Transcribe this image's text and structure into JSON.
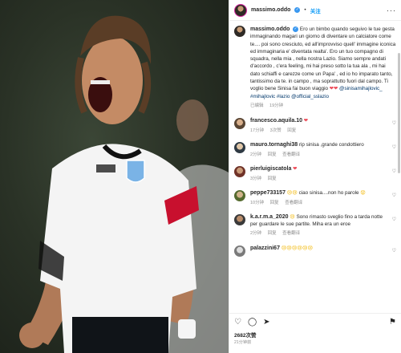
{
  "post": {
    "username": "massimo.oddo",
    "follow_label": "关注",
    "more_label": "···",
    "caption": {
      "username": "massimo.oddo",
      "text": "Ero un bimbo quando seguivo le tue gesta immaginando magari un giorno di diventare un calciatore come te.... poi sono cresciuto, ed all'improvviso quell' immagine iconica ed immaginaria e' diventata realta'. Ero un tuo compagno di squadra, nella mia , nella nostra Lazio. Siamo sempre andati d'accordo , c'era feeling, mi hai preso sotto la tua ala , mi hai dato schiaffi e carezze come un Papa' , ed io ho imparato tanto, tantissimo da te. in campo , ma soprattutto fuori dal campo. Ti voglio bene Sinisa fai buon viaggio",
      "hearts": "❤❤",
      "tags": "@sinisamihajlovic_ #mihajlovic #lazio @official_sslazio",
      "meta": [
        "已编辑",
        "19分钟"
      ]
    },
    "comments": [
      {
        "username": "francesco.aquila.10",
        "text": "",
        "suffix": "❤",
        "meta": [
          "17分钟",
          "3次赞",
          "回复"
        ]
      },
      {
        "username": "mauro.tornaghi38",
        "text": "rip sinisa ,grande condottiero",
        "suffix": "",
        "meta": [
          "2分钟",
          "回复",
          "查看翻译"
        ]
      },
      {
        "username": "pierluigiscatola",
        "text": "",
        "suffix": "❤",
        "meta": [
          "3分钟",
          "回复"
        ]
      },
      {
        "username": "peppe733157",
        "text": "ciao sinisa....non ho parole",
        "prefix": "😢😢",
        "suffix": "😟",
        "meta": [
          "10分钟",
          "回复",
          "查看翻译"
        ]
      },
      {
        "username": "k.a.r.m.a_2020",
        "text": "Sono rimasto sveglio fino a tarda notte per guardare le sue partite. Miha era un eroe",
        "prefix": "😢",
        "suffix": "",
        "meta": [
          "2分钟",
          "回复",
          "查看翻译"
        ]
      },
      {
        "username": "palazzini67",
        "text": "",
        "prefix": "😢😢😢😢😢😢",
        "suffix": "",
        "meta": []
      }
    ],
    "likes": "2682次赞",
    "date": "21分钟前"
  },
  "colors": {
    "accent": "#0095f6",
    "link": "#00376b",
    "heart": "#ed4956",
    "muted": "#8e8e8e"
  }
}
